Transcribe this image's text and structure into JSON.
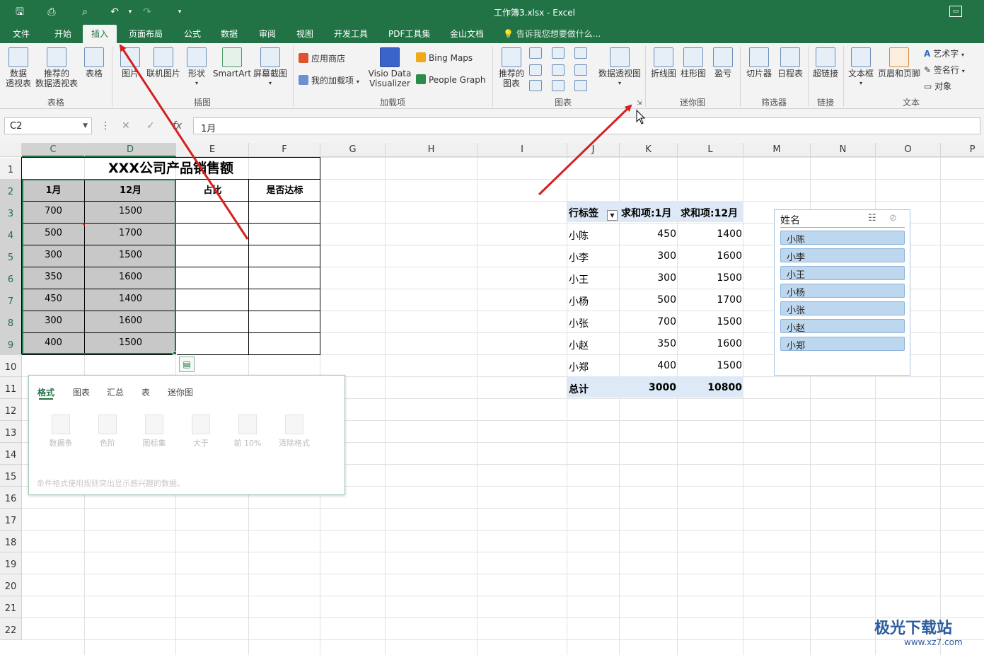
{
  "window": {
    "title": "工作簿3.xlsx - Excel"
  },
  "menu": {
    "tabs": [
      "文件",
      "开始",
      "插入",
      "页面布局",
      "公式",
      "数据",
      "审阅",
      "视图",
      "开发工具",
      "PDF工具集",
      "金山文档"
    ],
    "active": "插入",
    "tell_me": "告诉我您想要做什么..."
  },
  "ribbon": {
    "tables": {
      "pivot": "数据\n透视表",
      "recommended_pivot": "推荐的\n数据透视表",
      "table": "表格",
      "group": "表格"
    },
    "illustrations": {
      "picture": "图片",
      "online_picture": "联机图片",
      "shapes": "形状",
      "smartart": "SmartArt",
      "screenshot": "屏幕截图",
      "group": "插图"
    },
    "addins": {
      "store": "应用商店",
      "my_addins": "我的加载项",
      "visio": "Visio Data\nVisualizer",
      "bing": "Bing Maps",
      "people": "People Graph",
      "group": "加载项"
    },
    "charts": {
      "recommended": "推荐的\n图表",
      "pivot_chart": "数据透视图",
      "group": "图表"
    },
    "sparklines": {
      "line": "折线图",
      "column": "柱形图",
      "winloss": "盈亏",
      "group": "迷你图"
    },
    "filters": {
      "slicer": "切片器",
      "timeline": "日程表",
      "group": "筛选器"
    },
    "links": {
      "hyperlink": "超链接",
      "group": "链接"
    },
    "text": {
      "textbox": "文本框",
      "header_footer": "页眉和页脚",
      "wordart": "艺术字",
      "signature": "签名行",
      "object": "对象",
      "group": "文本"
    }
  },
  "formula_bar": {
    "name_box": "C2",
    "formula": "1月"
  },
  "columns": [
    "C",
    "D",
    "E",
    "F",
    "G",
    "H",
    "I",
    "J",
    "K",
    "L",
    "M",
    "N",
    "O",
    "P"
  ],
  "rows": [
    "1",
    "2",
    "3",
    "4",
    "5",
    "6",
    "7",
    "8",
    "9",
    "10",
    "11",
    "12",
    "13",
    "14",
    "15",
    "16",
    "17",
    "18",
    "19",
    "20",
    "21",
    "22"
  ],
  "table": {
    "title": "XXX公司产品销售额",
    "headers": [
      "1月",
      "12月",
      "占比",
      "是否达标"
    ],
    "jan": [
      "700",
      "500",
      "300",
      "350",
      "450",
      "300",
      "400"
    ],
    "dec": [
      "1500",
      "1700",
      "1500",
      "1600",
      "1400",
      "1600",
      "1500"
    ]
  },
  "quick_analysis": {
    "tabs": [
      "格式",
      "图表",
      "汇总",
      "表",
      "迷你图"
    ],
    "active": "格式",
    "items": [
      "数据条",
      "色阶",
      "图标集",
      "大于",
      "前 10%",
      "清除格式"
    ],
    "description": "条件格式使用规则突出显示感兴趣的数据。"
  },
  "pivot": {
    "header": [
      "行标签",
      "求和项:1月",
      "求和项:12月"
    ],
    "rows": [
      {
        "name": "小陈",
        "jan": "450",
        "dec": "1400"
      },
      {
        "name": "小李",
        "jan": "300",
        "dec": "1600"
      },
      {
        "name": "小王",
        "jan": "300",
        "dec": "1500"
      },
      {
        "name": "小杨",
        "jan": "500",
        "dec": "1700"
      },
      {
        "name": "小张",
        "jan": "700",
        "dec": "1500"
      },
      {
        "name": "小赵",
        "jan": "350",
        "dec": "1600"
      },
      {
        "name": "小郑",
        "jan": "400",
        "dec": "1500"
      }
    ],
    "total": {
      "name": "总计",
      "jan": "3000",
      "dec": "10800"
    }
  },
  "slicer": {
    "title": "姓名",
    "items": [
      "小陈",
      "小李",
      "小王",
      "小杨",
      "小张",
      "小赵",
      "小郑"
    ]
  },
  "watermark": {
    "text": "极光下载站",
    "sub": "www.xz7.com"
  },
  "colors": {
    "excel_green": "#217346",
    "arrow_red": "#d42020",
    "slicer_blue": "#bdd7ee",
    "pivot_header": "#dde9f6"
  }
}
